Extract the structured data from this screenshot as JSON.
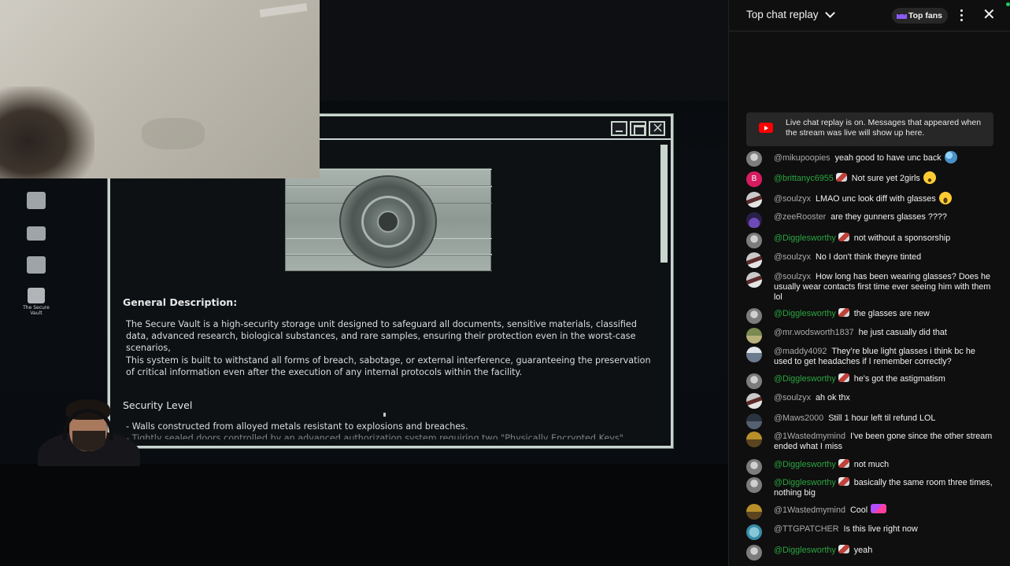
{
  "stream": {
    "desktop_icons": [
      {
        "name": "recycle-bin",
        "label": ""
      },
      {
        "name": "folder",
        "label": ""
      },
      {
        "name": "computer",
        "label": ""
      },
      {
        "name": "disk",
        "label": "The Secure Vault"
      }
    ],
    "document": {
      "heading_general": "General Description:",
      "para1": "The Secure Vault is a high-security storage unit designed to safeguard all documents, sensitive materials, classified data, advanced research, biological substances, and rare samples, ensuring their protection even in the worst-case scenarios,",
      "para2": "This system is built to withstand all forms of breach, sabotage, or external interference, guaranteeing the preservation of critical information even after the execution of any internal protocols within the facility.",
      "heading_security": "Security Level",
      "para3": "- Walls constructed from alloyed metals resistant to explosions and breaches.",
      "para4": "- Tightly sealed doors controlled by an advanced authorization system requiring two \"Physically Encrypted Keys\""
    }
  },
  "chat": {
    "title": "Top chat replay",
    "top_fans_label": "Top fans",
    "banner_text": "Live chat replay is on. Messages that appeared when the stream was live will show up here.",
    "messages": [
      {
        "author": "@mikupoopies",
        "text": "yeah good to have unc back",
        "member": false,
        "emoji": "hug"
      },
      {
        "author": "@brittanyc6955",
        "text": "Not sure yet 2girls",
        "member": true,
        "emoji": "astonished",
        "avatar_letter": "B"
      },
      {
        "author": "@soulzyx",
        "text": "LMAO unc look diff with glasses",
        "member": false,
        "emoji": "laugh"
      },
      {
        "author": "@zeeRooster",
        "text": "are they gunners glasses ????",
        "member": false
      },
      {
        "author": "@Digglesworthy",
        "text": "not without a sponsorship",
        "member": true
      },
      {
        "author": "@soulzyx",
        "text": "No I don't think theyre tinted",
        "member": false
      },
      {
        "author": "@soulzyx",
        "text": "How long has been wearing glasses? Does he usually wear contacts first time ever seeing him with them lol",
        "member": false
      },
      {
        "author": "@Digglesworthy",
        "text": "the glasses are new",
        "member": true
      },
      {
        "author": "@mr.wodsworth1837",
        "text": "he just casually did that",
        "member": false
      },
      {
        "author": "@maddy4092",
        "text": "They’re blue light glasses i think bc he used to get headaches if I remember correctly?",
        "member": false
      },
      {
        "author": "@Digglesworthy",
        "text": "he's got the astigmatism",
        "member": true
      },
      {
        "author": "@soulzyx",
        "text": "ah ok thx",
        "member": false
      },
      {
        "author": "@Maws2000",
        "text": "Still 1 hour left til refund LOL",
        "member": false
      },
      {
        "author": "@1Wastedmymind",
        "text": "I've been gone since the other stream ended what I miss",
        "member": false
      },
      {
        "author": "@Digglesworthy",
        "text": "not much",
        "member": true
      },
      {
        "author": "@Digglesworthy",
        "text": "basically the same room three times, nothing big",
        "member": true
      },
      {
        "author": "@1Wastedmymind",
        "text": "Cool",
        "member": false,
        "emoji": "sparkle"
      },
      {
        "author": "@TTGPATCHER",
        "text": "Is this live right now",
        "member": false
      },
      {
        "author": "@Digglesworthy",
        "text": "yeah",
        "member": true
      }
    ]
  }
}
